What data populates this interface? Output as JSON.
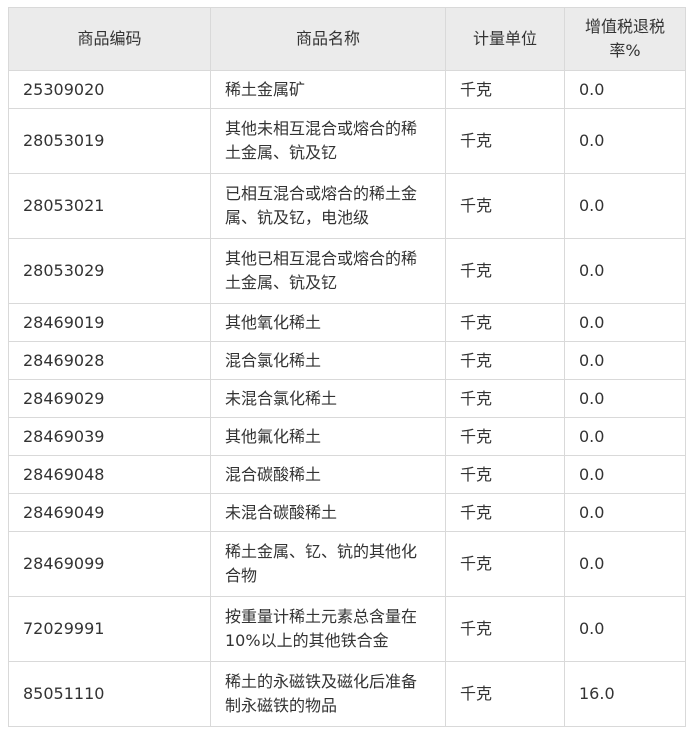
{
  "table": {
    "headers": [
      "商品编码",
      "商品名称",
      "计量单位",
      "增值税退税率%"
    ],
    "rows": [
      {
        "code": "25309020",
        "name": "稀土金属矿",
        "unit": "千克",
        "rate": "0.0"
      },
      {
        "code": "28053019",
        "name": "其他未相互混合或熔合的稀土金属、钪及钇",
        "unit": "千克",
        "rate": "0.0"
      },
      {
        "code": "28053021",
        "name": "已相互混合或熔合的稀土金属、钪及钇，电池级",
        "unit": "千克",
        "rate": "0.0"
      },
      {
        "code": "28053029",
        "name": "其他已相互混合或熔合的稀土金属、钪及钇",
        "unit": "千克",
        "rate": "0.0"
      },
      {
        "code": "28469019",
        "name": "其他氧化稀土",
        "unit": "千克",
        "rate": "0.0"
      },
      {
        "code": "28469028",
        "name": "混合氯化稀土",
        "unit": "千克",
        "rate": "0.0"
      },
      {
        "code": "28469029",
        "name": "未混合氯化稀土",
        "unit": "千克",
        "rate": "0.0"
      },
      {
        "code": "28469039",
        "name": "其他氟化稀土",
        "unit": "千克",
        "rate": "0.0"
      },
      {
        "code": "28469048",
        "name": "混合碳酸稀土",
        "unit": "千克",
        "rate": "0.0"
      },
      {
        "code": "28469049",
        "name": "未混合碳酸稀土",
        "unit": "千克",
        "rate": "0.0"
      },
      {
        "code": "28469099",
        "name": "稀土金属、钇、钪的其他化合物",
        "unit": "千克",
        "rate": "0.0"
      },
      {
        "code": "72029991",
        "name": "按重量计稀土元素总含量在10%以上的其他铁合金",
        "unit": "千克",
        "rate": "0.0"
      },
      {
        "code": "85051110",
        "name": "稀土的永磁铁及磁化后准备制永磁铁的物品",
        "unit": "千克",
        "rate": "16.0"
      }
    ]
  }
}
